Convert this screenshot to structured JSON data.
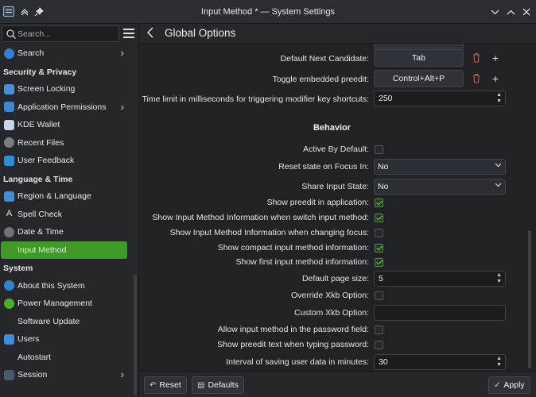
{
  "window": {
    "title": "Input Method * — System Settings"
  },
  "sidebar": {
    "search_placeholder": "Search...",
    "items": [
      {
        "label": "Search",
        "type": "item",
        "icon": "search-icon",
        "color": "#2f7fd6",
        "chevron": true
      },
      {
        "label": "Security & Privacy",
        "type": "header"
      },
      {
        "label": "Screen Locking",
        "type": "item",
        "icon": "screen-lock-icon",
        "color": "#4a8fd9"
      },
      {
        "label": "Application Permissions",
        "type": "item",
        "icon": "shield-icon",
        "color": "#3b86d8",
        "chevron": true
      },
      {
        "label": "KDE Wallet",
        "type": "item",
        "icon": "wallet-icon",
        "color": "#c8d4e6"
      },
      {
        "label": "Recent Files",
        "type": "item",
        "icon": "clock-icon",
        "color": "#7a7d82"
      },
      {
        "label": "User Feedback",
        "type": "item",
        "icon": "feedback-icon",
        "color": "#2b8fd8"
      },
      {
        "label": "Language & Time",
        "type": "header"
      },
      {
        "label": "Region & Language",
        "type": "item",
        "icon": "globe-icon",
        "color": "#3a8ede"
      },
      {
        "label": "Spell Check",
        "type": "item",
        "icon": "spell-check-icon",
        "color": "#25272b"
      },
      {
        "label": "Date & Time",
        "type": "item",
        "icon": "clock-icon",
        "color": "#6f7378"
      },
      {
        "label": "Input Method",
        "type": "item",
        "icon": "input-method-icon",
        "color": "#3f9a26",
        "active": true
      },
      {
        "label": "System",
        "type": "header"
      },
      {
        "label": "About this System",
        "type": "item",
        "icon": "info-icon",
        "color": "#2f86d8"
      },
      {
        "label": "Power Management",
        "type": "item",
        "icon": "power-icon",
        "color": "#48b02c"
      },
      {
        "label": "Software Update",
        "type": "item",
        "icon": "update-icon",
        "color": "#25272b"
      },
      {
        "label": "Users",
        "type": "item",
        "icon": "users-icon",
        "color": "#3b8de0"
      },
      {
        "label": "Autostart",
        "type": "item",
        "icon": "autostart-icon",
        "color": "#25272b"
      },
      {
        "label": "Session",
        "type": "item",
        "icon": "session-icon",
        "color": "#4b5866",
        "chevron": true
      }
    ]
  },
  "main": {
    "title": "Global Options",
    "shortcut_rows": [
      {
        "label": "Default Next Candidate:",
        "value": "Tab"
      },
      {
        "label": "Toggle embedded preedit:",
        "value": "Control+Alt+P"
      }
    ],
    "time_limit": {
      "label": "Time limit in milliseconds for triggering modifier key shortcuts:",
      "value": "250"
    },
    "behavior_title": "Behavior",
    "behavior_rows": [
      {
        "label": "Active By Default:",
        "kind": "checkbox",
        "checked": false
      },
      {
        "label": "Reset state on Focus In:",
        "kind": "combo",
        "value": "No"
      },
      {
        "label": "Share Input State:",
        "kind": "combo",
        "value": "No"
      },
      {
        "label": "Show preedit in application:",
        "kind": "checkbox",
        "checked": true
      },
      {
        "label": "Show Input Method Information when switch input method:",
        "kind": "checkbox",
        "checked": true
      },
      {
        "label": "Show Input Method Information when changing focus:",
        "kind": "checkbox",
        "checked": false
      },
      {
        "label": "Show compact input method information:",
        "kind": "checkbox",
        "checked": true
      },
      {
        "label": "Show first input method information:",
        "kind": "checkbox",
        "checked": true
      },
      {
        "label": "Default page size:",
        "kind": "spin",
        "value": "5"
      },
      {
        "label": "Override Xkb Option:",
        "kind": "checkbox",
        "checked": false
      },
      {
        "label": "Custom Xkb Option:",
        "kind": "text",
        "value": ""
      },
      {
        "label": "Allow input method in the password field:",
        "kind": "checkbox",
        "checked": false
      },
      {
        "label": "Show preedit text when typing password:",
        "kind": "checkbox",
        "checked": false
      },
      {
        "label": "Interval of saving user data in minutes:",
        "kind": "spin",
        "value": "30"
      }
    ]
  },
  "footer": {
    "reset_label": "Reset",
    "defaults_label": "Defaults",
    "apply_label": "Apply"
  },
  "colors": {
    "accent": "#3f9a26",
    "checkbox_check": "#7fd35b",
    "trash": "#d9534f"
  }
}
